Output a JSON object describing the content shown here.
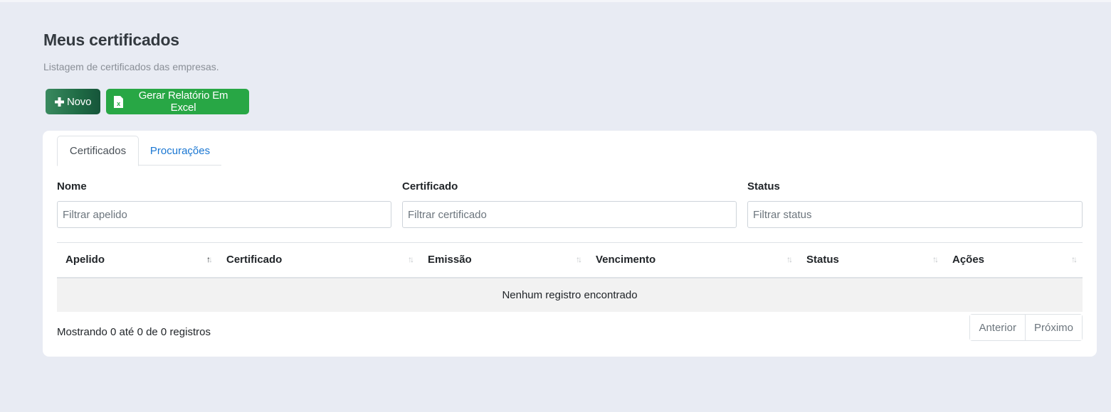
{
  "header": {
    "title": "Meus certificados",
    "subtitle": "Listagem de certificados das empresas."
  },
  "toolbar": {
    "novo_label": "Novo",
    "novo_icon": "plus-icon",
    "excel_label": "Gerar Relatório Em Excel",
    "excel_icon": "excel-file-icon"
  },
  "tabs": [
    {
      "label": "Certificados",
      "active": true
    },
    {
      "label": "Procurações",
      "active": false
    }
  ],
  "filters": [
    {
      "label": "Nome",
      "placeholder": "Filtrar apelido"
    },
    {
      "label": "Certificado",
      "placeholder": "Filtrar certificado"
    },
    {
      "label": "Status",
      "placeholder": "Filtrar status"
    }
  ],
  "table": {
    "columns": [
      "Apelido",
      "Certificado",
      "Emissão",
      "Vencimento",
      "Status",
      "Ações"
    ],
    "empty_message": "Nenhum registro encontrado"
  },
  "footer": {
    "info": "Mostrando 0 até 0 de 0 registros",
    "prev_label": "Anterior",
    "next_label": "Próximo"
  },
  "colors": {
    "background": "#e8ebf3",
    "primary_green": "#28a745",
    "dark_green": "#1f6b45",
    "link_blue": "#1976d2"
  }
}
